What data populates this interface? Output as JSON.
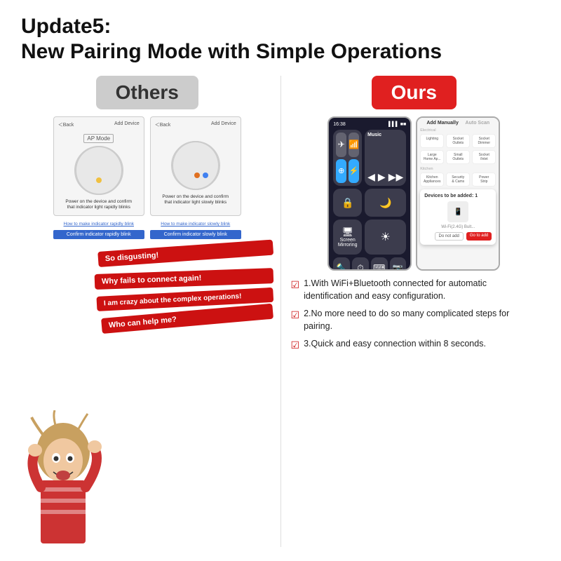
{
  "header": {
    "title_line1": "Update5:",
    "title_line2": "New Pairing Mode with Simple Operations"
  },
  "left": {
    "label": "Others",
    "screen1": {
      "top_left": "＜Back",
      "top_right": "Add Device",
      "mode_btn": "AP Mode",
      "caption": "Power on the device and confirm\nthat indicator light rapidly blinks"
    },
    "screen2": {
      "top_left": "＜Back",
      "top_right": "Add Device",
      "caption": "Power on the device and confirm\nthat indicator light slowly blinks"
    },
    "link1": "How to make indicator rapidly blink",
    "link2": "How to make indicator slowly blink",
    "btn1": "Confirm indicator rapidly blink",
    "btn2": "Confirm indicator slowly blink",
    "bubbles": [
      "So disgusting!",
      "Why fails to connect again!",
      "I am crazy about the complex operations!",
      "Who can help me?"
    ]
  },
  "right": {
    "label": "Ours",
    "control_center": {
      "time": "16:38",
      "signal": "▌▌▌",
      "battery": "■■■",
      "tiles": [
        {
          "icon": "✈",
          "label": ""
        },
        {
          "icon": "📶",
          "label": ""
        },
        {
          "icon": "📻",
          "label": "Music"
        },
        {
          "icon": "",
          "label": ""
        },
        {
          "icon": "📷",
          "label": ""
        },
        {
          "icon": "🌑",
          "label": ""
        },
        {
          "icon": "🖥",
          "label": "Screen\nMirror"
        },
        {
          "icon": "☀",
          "label": ""
        }
      ]
    },
    "tuya_app": {
      "header": "Add Manually  Auto Scan",
      "categories": [
        "Lighting",
        "Large\nHome Ap...",
        "Kitchen\nAppliances",
        "Security\n& Cameras"
      ],
      "dialog_title": "Devices to be added: 1",
      "device_name": "Wi-Fi(2.4G) Bult...",
      "btn_cancel": "Do not add",
      "btn_add": "Go to add"
    },
    "features": [
      "1.With WiFi+Bluetooth connected for automatic identification and easy configuration.",
      "2.No more need to do so many complicated steps for pairing.",
      "3.Quick and easy connection within 8 seconds."
    ]
  },
  "colors": {
    "accent_red": "#e02020",
    "label_gray": "#cccccc",
    "check_red": "#cc1111",
    "bubble_red": "#cc1111"
  }
}
